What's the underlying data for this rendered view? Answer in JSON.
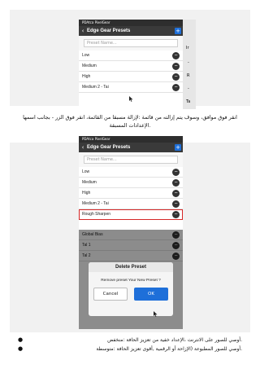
{
  "app_name": "PDAtca PixelGear",
  "screen_title": "Edge Gear Presets",
  "search_placeholder": "Preset Name...",
  "add_label": "+",
  "back_label": "‹",
  "remove_label": "−",
  "side_letters": [
    "Ir",
    "-",
    "R",
    "-",
    "Ta"
  ],
  "screen1_items": [
    "Low",
    "Medium",
    "High",
    "Medium 2 - Tai"
  ],
  "screen2_items": [
    "Low",
    "Medium",
    "High",
    "Medium 2 - Tai",
    "Rough Sharpen"
  ],
  "screen3_items": [
    "Global Bias",
    "Tal 1",
    "Tal 2"
  ],
  "dialog": {
    "title": "Delete Preset",
    "message": "Remove preset Your New Preset ?",
    "cancel": "Cancel",
    "ok": "OK"
  },
  "instruction_line1": "انقر فوق موافق، وسوف يتم إزالته من قائمة :لإزالة مسبقا من القائمة، انقر فوق الزر - بجانب اسمها",
  "instruction_line2": ".الإعدادات المسبقة",
  "bullet1": ".أوصي للصور على الانترنت ،الإعداد خفية من تعزيز الحافة :منخفض",
  "bullet2": ".أوصي للصور المطبوعة (الإزاحة أو الرقمية ,أقوى تعزيز الحافة :متوسطة",
  "accent_color": "#1e6fd9",
  "highlight_color": "#d62828"
}
